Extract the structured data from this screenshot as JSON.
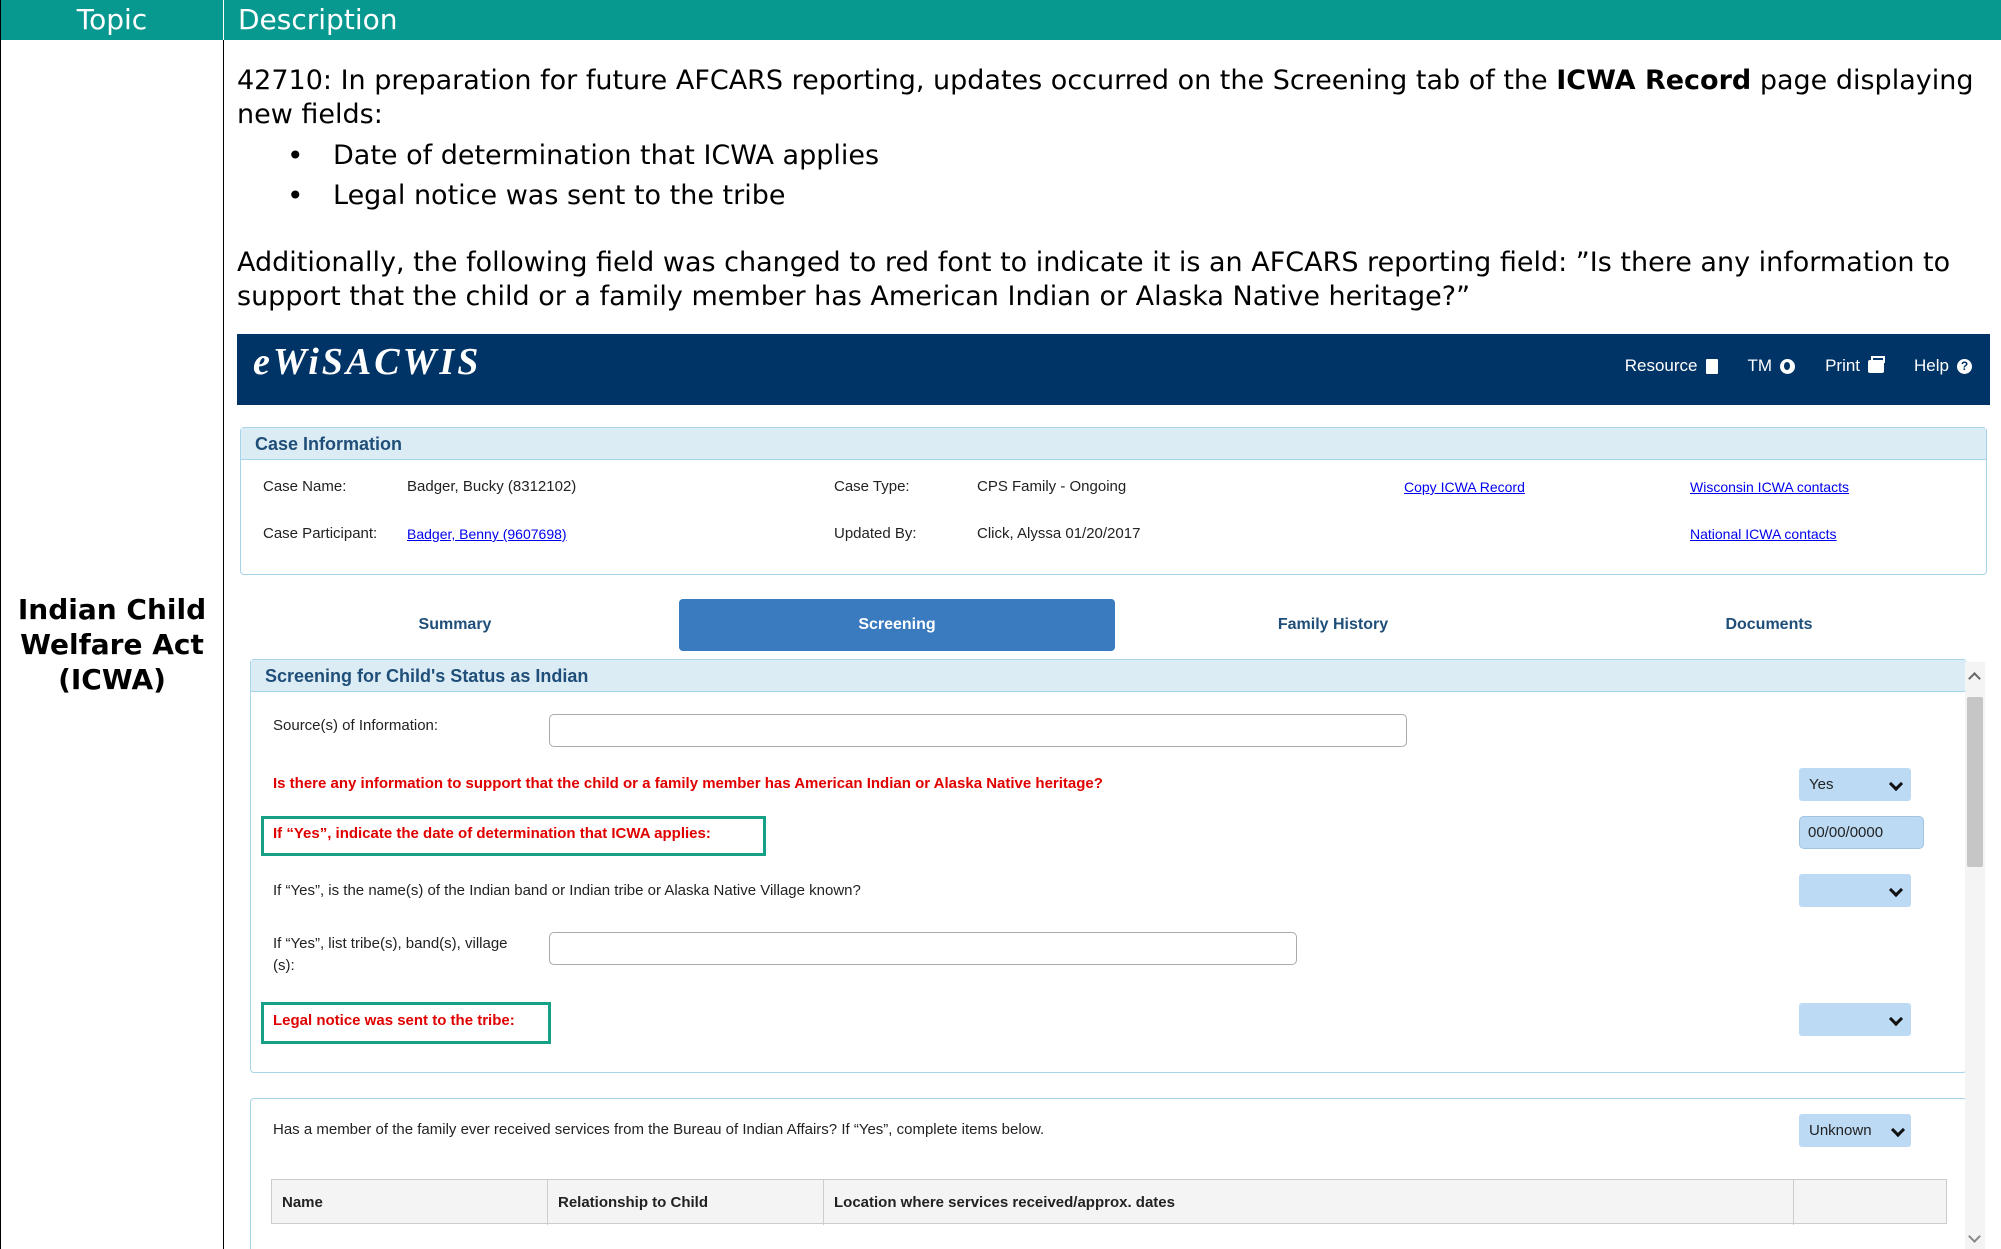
{
  "table": {
    "header_topic": "Topic",
    "header_description": "Description",
    "topic_lines": [
      "Indian Child",
      "Welfare Act",
      "(ICWA)"
    ]
  },
  "description": {
    "p1_pre": "42710: In preparation for future AFCARS reporting, updates occurred on the Screening tab of the ",
    "p1_bold": "ICWA Record",
    "p1_post": " page displaying new fields:",
    "bullets": [
      "Date of determination that ICWA applies",
      "Legal notice was sent to the tribe"
    ],
    "p2": "Additionally, the following field was changed to red font to indicate it is an AFCARS reporting field: ”Is there any information to support that the child or a family member has American Indian or Alaska Native heritage?”"
  },
  "app": {
    "logo": "eWiSACWIS",
    "nav": [
      {
        "label": "Resource",
        "icon": "book-icon"
      },
      {
        "label": "TM",
        "icon": "globe-icon"
      },
      {
        "label": "Print",
        "icon": "print-icon"
      },
      {
        "label": "Help",
        "icon": "help-icon"
      }
    ]
  },
  "case_info": {
    "title": "Case Information",
    "case_name_label": "Case Name:",
    "case_name": "Badger, Bucky (8312102)",
    "case_type_label": "Case Type:",
    "case_type": "CPS Family - Ongoing",
    "copy_link": "Copy ICWA Record",
    "wi_link": "Wisconsin ICWA contacts",
    "participant_label": "Case Participant:",
    "participant": "Badger, Benny (9607698)",
    "updated_label": "Updated By:",
    "updated": "Click, Alyssa 01/20/2017",
    "national_link": "National ICWA contacts"
  },
  "tabs": [
    {
      "label": "Summary",
      "active": false
    },
    {
      "label": "Screening",
      "active": true
    },
    {
      "label": "Family History",
      "active": false
    },
    {
      "label": "Documents",
      "active": false
    }
  ],
  "screening": {
    "title": "Screening for Child's Status as Indian",
    "source_label": "Source(s) of Information:",
    "heritage_q": "Is there any information to support that the child or a family member has American Indian or Alaska Native heritage?",
    "heritage_value": "Yes",
    "date_q": "If “Yes”, indicate the date of determination that ICWA applies:",
    "date_value": "00/00/0000",
    "name_known_q": "If “Yes”, is the name(s) of the Indian band or Indian tribe or Alaska Native Village known?",
    "list_label_1": "If “Yes”, list tribe(s), band(s), village",
    "list_label_2": "(s):",
    "legal_q": "Legal notice was sent to the tribe:"
  },
  "bia": {
    "question": "Has a member of the family ever received services from the Bureau of Indian Affairs? If “Yes”, complete items below.",
    "value": "Unknown",
    "columns": [
      "Name",
      "Relationship to Child",
      "Location where services received/approx. dates"
    ]
  },
  "colors": {
    "header_teal": "#07988f",
    "banner_navy": "#003366",
    "afcars_red": "#e00000",
    "highlight_green": "#16a085",
    "active_tab": "#3a7bbf"
  }
}
